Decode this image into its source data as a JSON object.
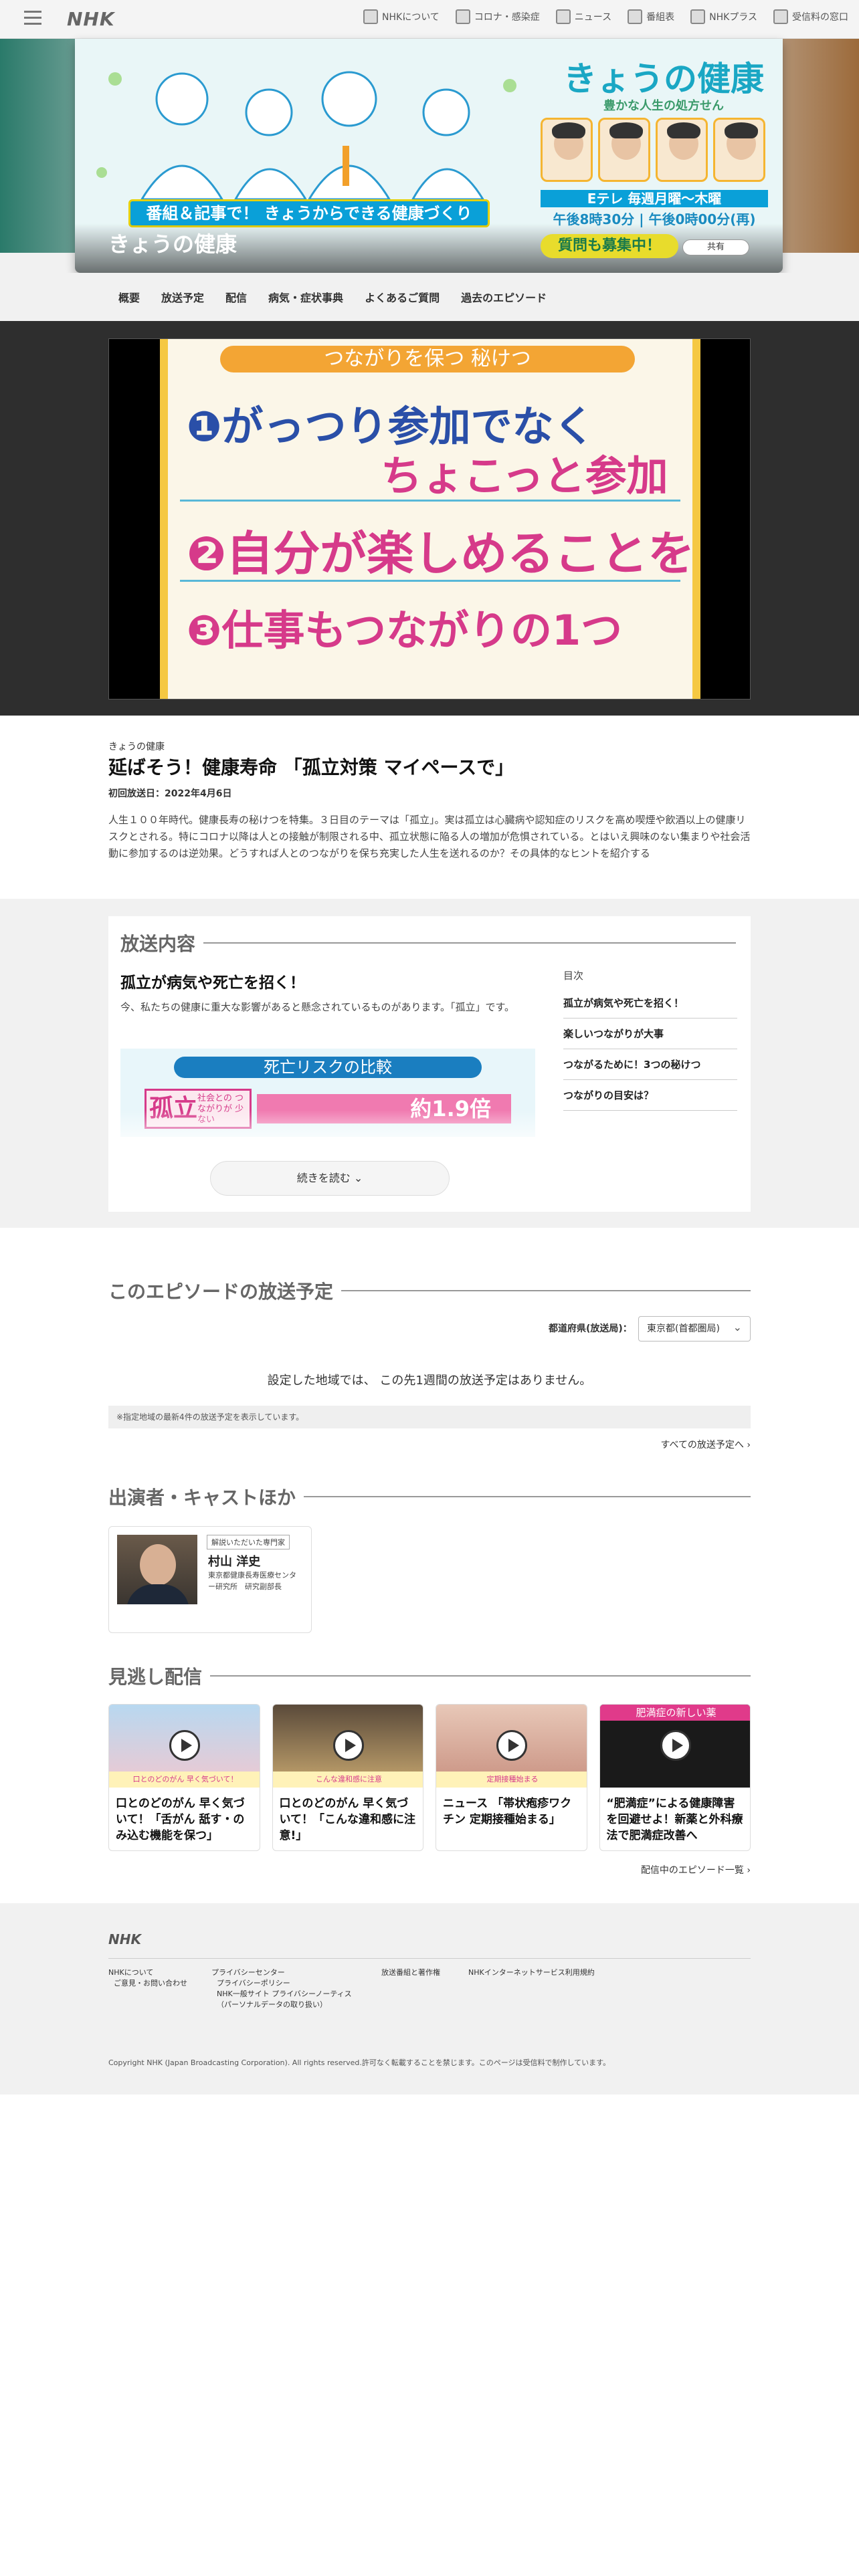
{
  "header": {
    "logo": "NHK",
    "nav": [
      {
        "label": "NHKについて",
        "icon": "nhk-building-icon"
      },
      {
        "label": "コロナ・感染症",
        "icon": "notice-icon"
      },
      {
        "label": "ニュース",
        "icon": "news-icon"
      },
      {
        "label": "番組表",
        "icon": "grid-icon"
      },
      {
        "label": "NHKプラス",
        "icon": "play-screen-icon"
      },
      {
        "label": "受信料の窓口",
        "icon": "wallet-icon"
      }
    ]
  },
  "hero": {
    "banner": "番組＆記事で！ きょうからできる健康づくり",
    "program_name": "きょうの健康",
    "logo_text": "きょうの健康",
    "tagline": "豊かな人生の処方せん",
    "channel": "Eテレ 毎週月曜〜木曜",
    "times": "午後8時30分 | 午後0時00分(再)",
    "ask_button": "質問も募集中！",
    "share_button": "共有"
  },
  "subnav": [
    "概要",
    "放送予定",
    "配信",
    "病気・症状事典",
    "よくあるご質問",
    "過去のエピソード"
  ],
  "video": {
    "slide_title": "つながりを保つ 秘けつ",
    "line1a": "❶がっつり参加でなく",
    "line1b": "ちょこっと参加",
    "line2": "❷自分が楽しめることを",
    "line3": "❸仕事もつながりの1つ"
  },
  "episode": {
    "program": "きょうの健康",
    "title": "延ばそう！健康寿命 「孤立対策 マイペースで」",
    "first_air": "初回放送日：2022年4月6日",
    "description": "人生１００年時代。健康長寿の秘けつを特集。３日目のテーマは「孤立」。実は孤立は心臓病や認知症のリスクを高め喫煙や飲酒以上の健康リスクとされる。特にコロナ以降は人との接触が制限される中、孤立状態に陥る人の増加が危惧されている。とはいえ興味のない集まりや社会活動に参加するのは逆効果。どうすれば人とのつながりを保ち充実した人生を送れるのか？その具体的なヒントを紹介する"
  },
  "content": {
    "section_title": "放送内容",
    "heading": "孤立が病気や死亡を招く！",
    "text": "今、私たちの健康に重大な影響があると懸念されているものがあります。「孤立」です。",
    "figure_title": "死亡リスクの比較",
    "figure_label": "孤立",
    "figure_sub": "社会との つながりが 少ない",
    "figure_value": "約1.9倍",
    "more_button": "続きを読む",
    "toc_title": "目次",
    "toc": [
      "孤立が病気や死亡を招く！",
      "楽しいつながりが大事",
      "つながるために！3つの秘けつ",
      "つながりの目安は？"
    ]
  },
  "schedule": {
    "section_title": "このエピソードの放送予定",
    "pref_label": "都道府県(放送局)：",
    "pref_value": "東京都(首都圏局)",
    "none_text": "設定した地域では、 この先1週間の放送予定はありません。",
    "note": "※指定地域の最新4件の放送予定を表示しています。",
    "all_link": "すべての放送予定へ"
  },
  "cast": {
    "section_title": "出演者・キャストほか",
    "people": [
      {
        "tag": "解説いただいた専門家",
        "name": "村山 洋史",
        "affiliation": "東京都健康長寿医療センター研究所　研究副部長"
      }
    ]
  },
  "missed": {
    "section_title": "見逃し配信",
    "items": [
      {
        "title": "口とのどのがん 早く気づいて！「舌がん 舐す・のみ込む機能を保つ」",
        "caption": "口とのどのがん 早く気づいて！"
      },
      {
        "title": "口とのどのがん 早く気づいて！「こんな違和感に注意!」",
        "caption": "こんな違和感に注意"
      },
      {
        "title": "ニュース 「帯状疱疹ワクチン 定期接種始まる」",
        "caption": "定期接種始まる"
      },
      {
        "title": "“肥満症”による健康障害を回避せよ！新薬と外科療法で肥満症改善へ",
        "caption": "肥満症の新しい薬"
      }
    ],
    "all_link": "配信中のエピソード一覧"
  },
  "footer": {
    "logo": "NHK",
    "links": [
      "NHKについて",
      "ご意見・お問い合わせ",
      "プライバシーセンター",
      "プライバシーポリシー",
      "NHK一般サイト プライバシーノーティス（パーソナルデータの取り扱い）",
      "放送番組と著作権",
      "NHKインターネットサービス利用規約"
    ],
    "copyright": "Copyright NHK (Japan Broadcasting Corporation). All rights reserved.許可なく転載することを禁じます。このページは受信料で制作しています。"
  }
}
